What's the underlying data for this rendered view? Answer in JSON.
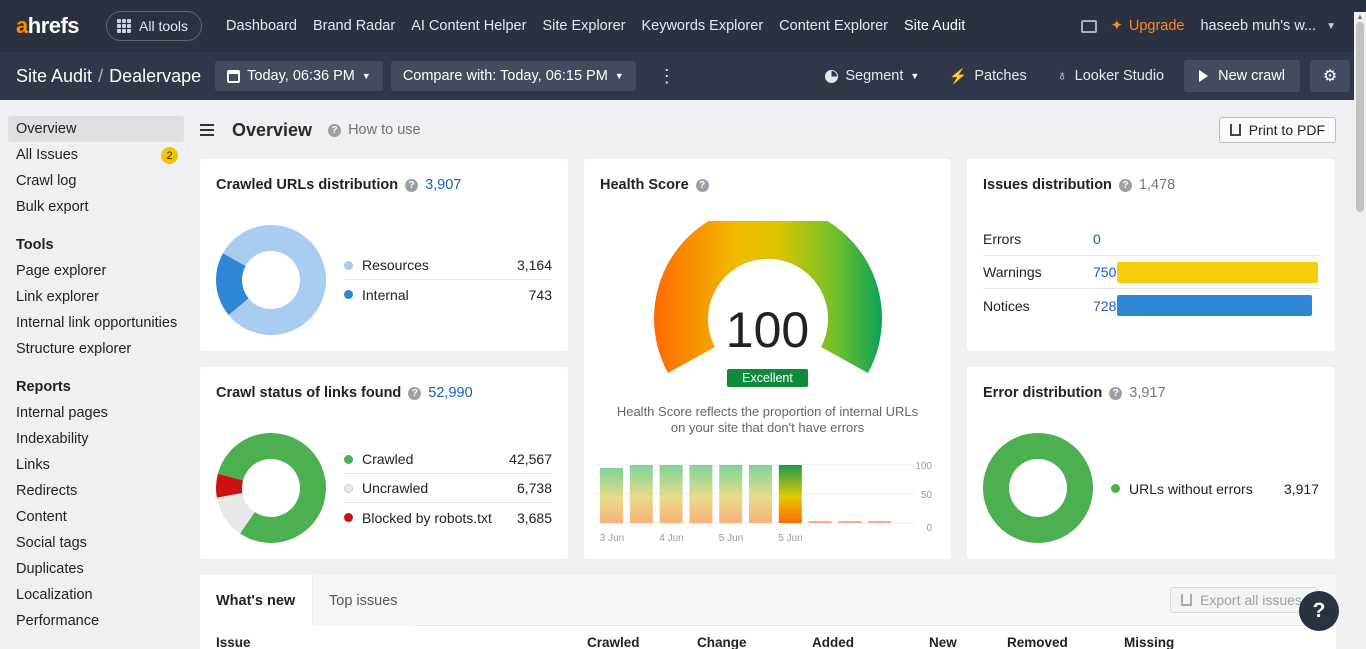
{
  "topnav": {
    "logo_a": "a",
    "logo_rest": "hrefs",
    "all_tools": "All tools",
    "items": [
      "Dashboard",
      "Brand Radar",
      "AI Content Helper",
      "Site Explorer",
      "Keywords Explorer",
      "Content Explorer",
      "Site Audit"
    ],
    "upgrade": "Upgrade",
    "user": "haseeb muh's w..."
  },
  "subbar": {
    "crumb_root": "Site Audit",
    "crumb_sep": "/",
    "project": "Dealervape",
    "date": "Today, 06:36 PM",
    "compare": "Compare with: Today, 06:15 PM",
    "segment": "Segment",
    "patches": "Patches",
    "looker": "Looker Studio",
    "new_crawl": "New crawl"
  },
  "sidebar": {
    "top": [
      {
        "label": "Overview",
        "active": true
      },
      {
        "label": "All Issues",
        "badge": "2"
      },
      {
        "label": "Crawl log"
      },
      {
        "label": "Bulk export"
      }
    ],
    "tools_head": "Tools",
    "tools": [
      "Page explorer",
      "Link explorer",
      "Internal link opportunities",
      "Structure explorer"
    ],
    "reports_head": "Reports",
    "reports": [
      "Internal pages",
      "Indexability",
      "Links",
      "Redirects",
      "Content",
      "Social tags",
      "Duplicates",
      "Localization",
      "Performance"
    ]
  },
  "main": {
    "title": "Overview",
    "how_to": "How to use",
    "print": "Print to PDF"
  },
  "crawled": {
    "title": "Crawled URLs distribution",
    "total": "3,907",
    "items": [
      {
        "label": "Resources",
        "value": "3,164",
        "color": "#a9cdf0"
      },
      {
        "label": "Internal",
        "value": "743",
        "color": "#2f86d6"
      }
    ]
  },
  "crawl_status": {
    "title": "Crawl status of links found",
    "total": "52,990",
    "items": [
      {
        "label": "Crawled",
        "value": "42,567",
        "color": "#4caf50"
      },
      {
        "label": "Uncrawled",
        "value": "6,738",
        "color": "#e8e8e8"
      },
      {
        "label": "Blocked by robots.txt",
        "value": "3,685",
        "color": "#cc1111"
      }
    ]
  },
  "health": {
    "title": "Health Score",
    "score": "100",
    "rating": "Excellent",
    "desc1": "Health Score reflects the proportion of internal URLs",
    "desc2": "on your site that don't have errors",
    "chart_data": {
      "type": "bar",
      "ylim": [
        0,
        100
      ],
      "yticks": [
        "100",
        "50",
        "0"
      ],
      "xticks": [
        "3 Jun",
        "4 Jun",
        "5 Jun",
        "5 Jun"
      ],
      "values": [
        95,
        100,
        100,
        100,
        100,
        100,
        100,
        3,
        3,
        3
      ]
    }
  },
  "issues": {
    "title": "Issues distribution",
    "total": "1,478",
    "rows": [
      {
        "label": "Errors",
        "value": "0",
        "share": 0,
        "color": "#f6c90e"
      },
      {
        "label": "Warnings",
        "value": "750",
        "share": 1.0,
        "color": "#f6cd0e"
      },
      {
        "label": "Notices",
        "value": "728",
        "share": 0.97,
        "color": "#2f86d6"
      }
    ]
  },
  "error_dist": {
    "title": "Error distribution",
    "total": "3,917",
    "items": [
      {
        "label": "URLs without errors",
        "value": "3,917",
        "color": "#4caf50"
      }
    ]
  },
  "table": {
    "tab_active": "What's new",
    "tab_inactive": "Top issues",
    "export": "Export all issues",
    "headers": [
      "Issue",
      "Crawled",
      "Change",
      "Added",
      "New",
      "Removed",
      "Missing"
    ]
  },
  "help": "?"
}
